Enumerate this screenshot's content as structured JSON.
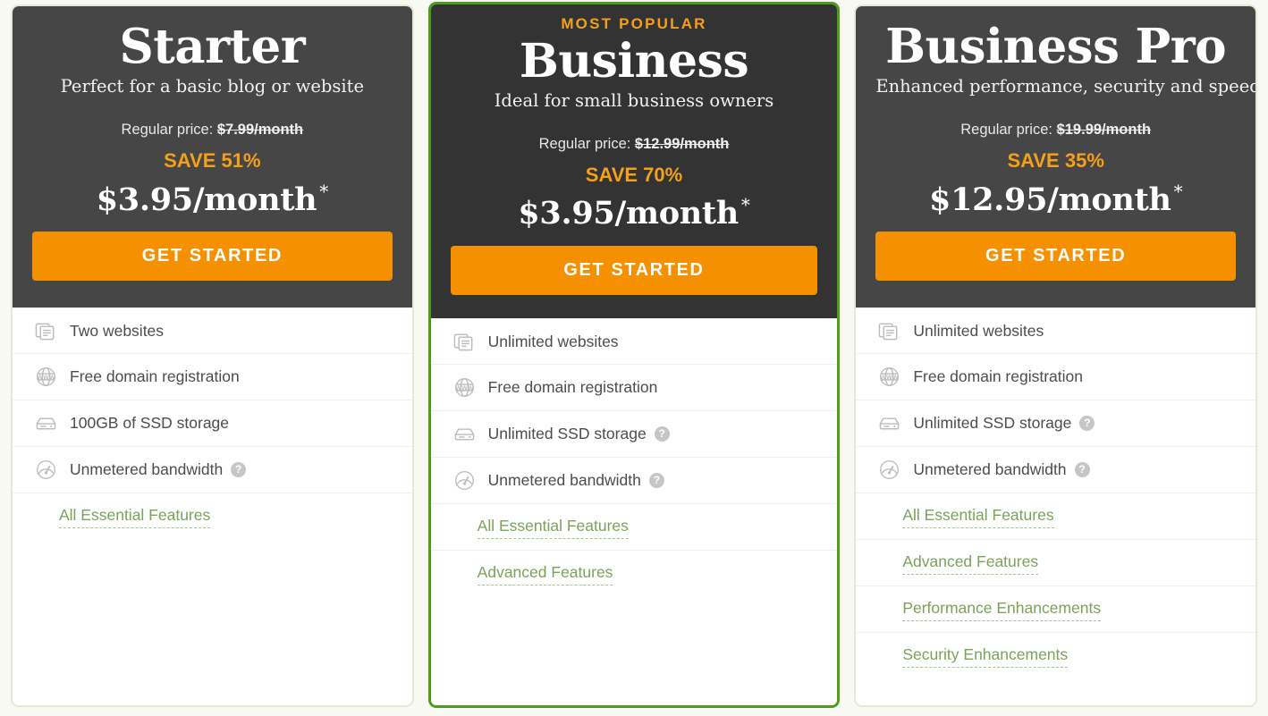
{
  "page": {
    "background_color": "#f7f9f2",
    "accent_orange": "#f59000",
    "accent_green": "#4c9c22",
    "link_green": "#7aa35a",
    "header_dark": "#464646",
    "header_dark_featured": "#333333"
  },
  "plans": [
    {
      "id": "starter",
      "badge": "",
      "name": "Starter",
      "tagline": "Perfect for a basic blog or website",
      "regular_price_label": "Regular price:",
      "regular_price_value": "$7.99/month",
      "save_text": "SAVE 51%",
      "price": "$3.95/month",
      "price_asterisk": "*",
      "cta_label": "GET STARTED",
      "features": [
        {
          "icon": "websites-icon",
          "label": "Two websites",
          "help": false
        },
        {
          "icon": "www-globe-icon",
          "label": "Free domain registration",
          "help": false
        },
        {
          "icon": "storage-drive-icon",
          "label": "100GB of SSD storage",
          "help": false
        },
        {
          "icon": "bandwidth-gauge-icon",
          "label": "Unmetered bandwidth",
          "help": true
        }
      ],
      "links": [
        "All Essential Features"
      ]
    },
    {
      "id": "business",
      "badge": "MOST POPULAR",
      "name": "Business",
      "tagline": "Ideal for small business owners",
      "regular_price_label": "Regular price:",
      "regular_price_value": "$12.99/month",
      "save_text": "SAVE 70%",
      "price": "$3.95/month",
      "price_asterisk": "*",
      "cta_label": "GET STARTED",
      "features": [
        {
          "icon": "websites-icon",
          "label": "Unlimited websites",
          "help": false
        },
        {
          "icon": "www-globe-icon",
          "label": "Free domain registration",
          "help": false
        },
        {
          "icon": "storage-drive-icon",
          "label": "Unlimited SSD storage",
          "help": true
        },
        {
          "icon": "bandwidth-gauge-icon",
          "label": "Unmetered bandwidth",
          "help": true
        }
      ],
      "links": [
        "All Essential Features",
        "Advanced Features"
      ]
    },
    {
      "id": "business-pro",
      "badge": "",
      "name": "Business Pro",
      "tagline": "Enhanced performance, security and speed",
      "regular_price_label": "Regular price:",
      "regular_price_value": "$19.99/month",
      "save_text": "SAVE 35%",
      "price": "$12.95/month",
      "price_asterisk": "*",
      "cta_label": "GET STARTED",
      "features": [
        {
          "icon": "websites-icon",
          "label": "Unlimited websites",
          "help": false
        },
        {
          "icon": "www-globe-icon",
          "label": "Free domain registration",
          "help": false
        },
        {
          "icon": "storage-drive-icon",
          "label": "Unlimited SSD storage",
          "help": true
        },
        {
          "icon": "bandwidth-gauge-icon",
          "label": "Unmetered bandwidth",
          "help": true
        }
      ],
      "links": [
        "All Essential Features",
        "Advanced Features",
        "Performance Enhancements",
        "Security Enhancements"
      ]
    }
  ],
  "icons": {
    "help_glyph": "?"
  }
}
